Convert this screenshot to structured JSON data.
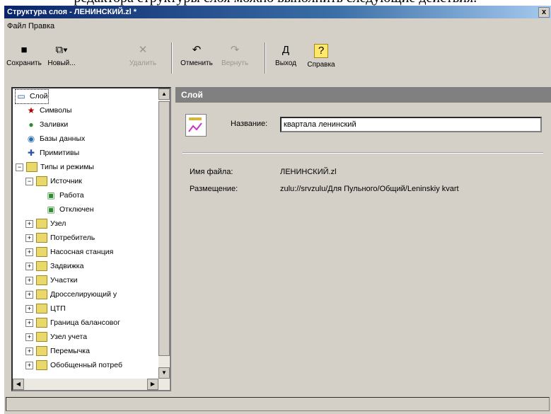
{
  "doc_caption": "редактора структуры слоя можно выполнить следующие действия:",
  "window": {
    "title": "Структура слоя - ЛЕНИНСКИЙ.zl *",
    "close": "x"
  },
  "menu": [
    "Файл",
    "Правка"
  ],
  "toolbar": [
    {
      "label": "Сохранить",
      "icon": "save-icon",
      "glyph": "■",
      "enabled": true
    },
    {
      "label": "Новый...",
      "icon": "new-icon",
      "glyph": "⧉▾",
      "enabled": true
    },
    {
      "label": "Удалить",
      "icon": "delete-icon",
      "glyph": "✕",
      "enabled": false
    },
    {
      "label": "Отменить",
      "icon": "undo-icon",
      "glyph": "↶",
      "enabled": true
    },
    {
      "label": "Вернуть",
      "icon": "redo-icon",
      "glyph": "↷",
      "enabled": false
    },
    {
      "label": "Выход",
      "icon": "exit-icon",
      "glyph": "Д",
      "enabled": true
    },
    {
      "label": "Справка",
      "icon": "help-icon",
      "glyph": "?",
      "enabled": true
    }
  ],
  "tree": [
    {
      "label": "Слой",
      "level": 0,
      "expander": "",
      "icon": "layer-icon",
      "glyph": "▭",
      "selected": true
    },
    {
      "label": "Символы",
      "level": 1,
      "expander": "",
      "icon": "star-icon",
      "glyph": "★"
    },
    {
      "label": "Заливки",
      "level": 1,
      "expander": "",
      "icon": "fill-icon",
      "glyph": "●"
    },
    {
      "label": "Базы данных",
      "level": 1,
      "expander": "",
      "icon": "database-icon",
      "glyph": "◉"
    },
    {
      "label": "Примитивы",
      "level": 1,
      "expander": "",
      "icon": "primitives-icon",
      "glyph": "✚"
    },
    {
      "label": "Типы и режимы",
      "level": 0,
      "expander": "−",
      "icon": "folder-icon",
      "glyph": ""
    },
    {
      "label": "Источник",
      "level": 1,
      "expander": "−",
      "icon": "folder-icon",
      "glyph": ""
    },
    {
      "label": "Работа",
      "level": 3,
      "expander": "",
      "icon": "mode-icon",
      "glyph": "▣"
    },
    {
      "label": "Отключен",
      "level": 3,
      "expander": "",
      "icon": "mode-icon",
      "glyph": "▣"
    },
    {
      "label": "Узел",
      "level": 1,
      "expander": "+",
      "icon": "folder-icon",
      "glyph": ""
    },
    {
      "label": "Потребитель",
      "level": 1,
      "expander": "+",
      "icon": "folder-icon",
      "glyph": ""
    },
    {
      "label": "Насосная станция",
      "level": 1,
      "expander": "+",
      "icon": "folder-icon",
      "glyph": ""
    },
    {
      "label": "Задвижка",
      "level": 1,
      "expander": "+",
      "icon": "folder-icon",
      "glyph": ""
    },
    {
      "label": "Участки",
      "level": 1,
      "expander": "+",
      "icon": "folder-icon",
      "glyph": ""
    },
    {
      "label": "Дросселирующий у",
      "level": 1,
      "expander": "+",
      "icon": "folder-icon",
      "glyph": ""
    },
    {
      "label": "ЦТП",
      "level": 1,
      "expander": "+",
      "icon": "folder-icon",
      "glyph": ""
    },
    {
      "label": "Граница балансовог",
      "level": 1,
      "expander": "+",
      "icon": "folder-icon",
      "glyph": ""
    },
    {
      "label": "Узел учета",
      "level": 1,
      "expander": "+",
      "icon": "folder-icon",
      "glyph": ""
    },
    {
      "label": "Перемычка",
      "level": 1,
      "expander": "+",
      "icon": "folder-icon",
      "glyph": ""
    },
    {
      "label": "Обобщенный потреб",
      "level": 1,
      "expander": "+",
      "icon": "folder-icon",
      "glyph": ""
    }
  ],
  "panel": {
    "header": "Слой",
    "name_label": "Название:",
    "name_value": "квартала ленинский",
    "file_label": "Имя файла:",
    "file_value": "ЛЕНИНСКИЙ.zl",
    "location_label": "Размещение:",
    "location_value": "zulu://srvzulu/Для Пульного/Общий/Leninskiy kvart"
  }
}
